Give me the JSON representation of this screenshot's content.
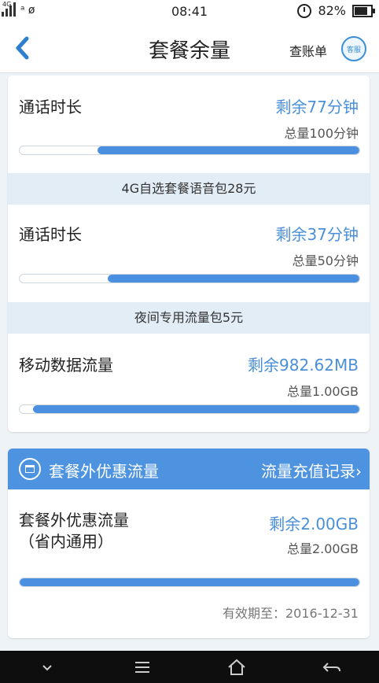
{
  "statusbar": {
    "network": "4G",
    "extra": "ᵃ ø",
    "time": "08:41",
    "battery": "82%"
  },
  "header": {
    "title": "套餐余量",
    "bill_link": "查账单",
    "service_icon_text": "客服"
  },
  "package_sections": [
    {
      "name": "通话时长",
      "remaining": "剩余77分钟",
      "total": "总量100分钟",
      "used_fraction": 0.23
    },
    {
      "band": "4G自选套餐语音包28元",
      "name": "通话时长",
      "remaining": "剩余37分钟",
      "total": "总量50分钟",
      "used_fraction": 0.26
    },
    {
      "band": "夜间专用流量包5元",
      "name": "移动数据流量",
      "remaining": "剩余982.62MB",
      "total": "总量1.00GB",
      "used_fraction": 0.04
    }
  ],
  "extra_card": {
    "title": "套餐外优惠流量",
    "link": "流量充值记录›",
    "name": "套餐外优惠流量（省内通用）",
    "remaining": "剩余2.00GB",
    "total": "总量2.00GB",
    "used_fraction": 0.0,
    "expiry": "有效期至：2016-12-31"
  },
  "colors": {
    "accent": "#4a8fd8",
    "progress": "#4a8fe0",
    "band_bg": "#e2edf6",
    "card_header": "#4d93e0"
  },
  "icons": [
    "back-chevron-icon",
    "customer-service-icon",
    "calendar-icon",
    "alarm-icon",
    "battery-icon",
    "nav-down-icon",
    "nav-menu-icon",
    "nav-home-icon",
    "nav-back-icon"
  ]
}
